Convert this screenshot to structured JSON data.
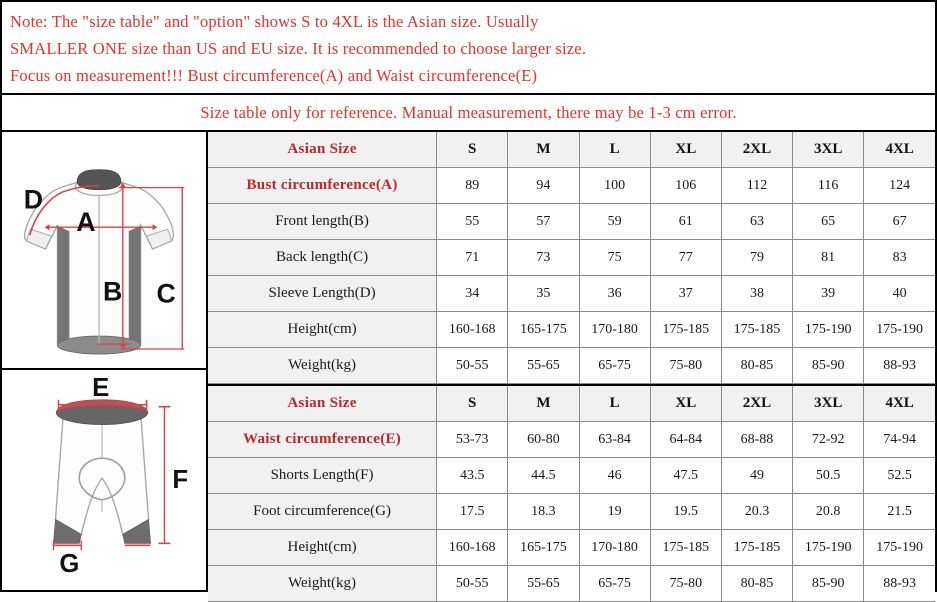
{
  "note": {
    "lines": [
      "Note: The \"size table\" and \"option\" shows S to 4XL is the Asian size. Usually",
      "SMALLER ONE size than US and EU size. It is recommended to choose larger size.",
      "Focus on measurement!!! Bust circumference(A) and Waist circumference(E)"
    ],
    "color": "#e8312a"
  },
  "reference_note": {
    "text": "Size table only for reference. Manual measurement, there may be 1-3 cm error.",
    "color": "#e8312a"
  },
  "colors": {
    "note_red": "#e8312a",
    "label_red": "#c0262a",
    "garment_gray": "#6e6e6e",
    "garment_dark": "#555555",
    "measure_red": "#e0404a",
    "outline_gray": "#999999",
    "header_bg": "#f1f1f1",
    "border": "#8a8a8a",
    "frame": "#000000"
  },
  "jersey_figure": {
    "name": "cycling-jersey-diagram",
    "labels": [
      {
        "id": "D",
        "text": "D",
        "meaning": "Sleeve Length"
      },
      {
        "id": "A",
        "text": "A",
        "meaning": "Bust circumference"
      },
      {
        "id": "B",
        "text": "B",
        "meaning": "Front length"
      },
      {
        "id": "C",
        "text": "C",
        "meaning": "Back length"
      }
    ]
  },
  "shorts_figure": {
    "name": "cycling-shorts-diagram",
    "labels": [
      {
        "id": "E",
        "text": "E",
        "meaning": "Waist circumference"
      },
      {
        "id": "F",
        "text": "F",
        "meaning": "Shorts Length"
      },
      {
        "id": "G",
        "text": "G",
        "meaning": "Foot circumference"
      }
    ]
  },
  "top_table": {
    "header": {
      "label": "Asian Size",
      "sizes": [
        "S",
        "M",
        "L",
        "XL",
        "2XL",
        "3XL",
        "4XL"
      ]
    },
    "rows": [
      {
        "label": "Bust circumference(A)",
        "red": true,
        "values": [
          "89",
          "94",
          "100",
          "106",
          "112",
          "116",
          "124"
        ]
      },
      {
        "label": "Front length(B)",
        "red": false,
        "values": [
          "55",
          "57",
          "59",
          "61",
          "63",
          "65",
          "67"
        ]
      },
      {
        "label": "Back length(C)",
        "red": false,
        "values": [
          "71",
          "73",
          "75",
          "77",
          "79",
          "81",
          "83"
        ]
      },
      {
        "label": "Sleeve Length(D)",
        "red": false,
        "values": [
          "34",
          "35",
          "36",
          "37",
          "38",
          "39",
          "40"
        ]
      },
      {
        "label": "Height(cm)",
        "red": false,
        "values": [
          "160-168",
          "165-175",
          "170-180",
          "175-185",
          "175-185",
          "175-190",
          "175-190"
        ]
      },
      {
        "label": "Weight(kg)",
        "red": false,
        "values": [
          "50-55",
          "55-65",
          "65-75",
          "75-80",
          "80-85",
          "85-90",
          "88-93"
        ]
      }
    ]
  },
  "bottom_table": {
    "header": {
      "label": "Asian Size",
      "sizes": [
        "S",
        "M",
        "L",
        "XL",
        "2XL",
        "3XL",
        "4XL"
      ]
    },
    "rows": [
      {
        "label": "Waist circumference(E)",
        "red": true,
        "values": [
          "53-73",
          "60-80",
          "63-84",
          "64-84",
          "68-88",
          "72-92",
          "74-94"
        ]
      },
      {
        "label": "Shorts Length(F)",
        "red": false,
        "values": [
          "43.5",
          "44.5",
          "46",
          "47.5",
          "49",
          "50.5",
          "52.5"
        ]
      },
      {
        "label": "Foot circumference(G)",
        "red": false,
        "values": [
          "17.5",
          "18.3",
          "19",
          "19.5",
          "20.3",
          "20.8",
          "21.5"
        ]
      },
      {
        "label": "Height(cm)",
        "red": false,
        "values": [
          "160-168",
          "165-175",
          "170-180",
          "175-185",
          "175-185",
          "175-190",
          "175-190"
        ]
      },
      {
        "label": "Weight(kg)",
        "red": false,
        "values": [
          "50-55",
          "55-65",
          "65-75",
          "75-80",
          "80-85",
          "85-90",
          "88-93"
        ]
      }
    ]
  }
}
